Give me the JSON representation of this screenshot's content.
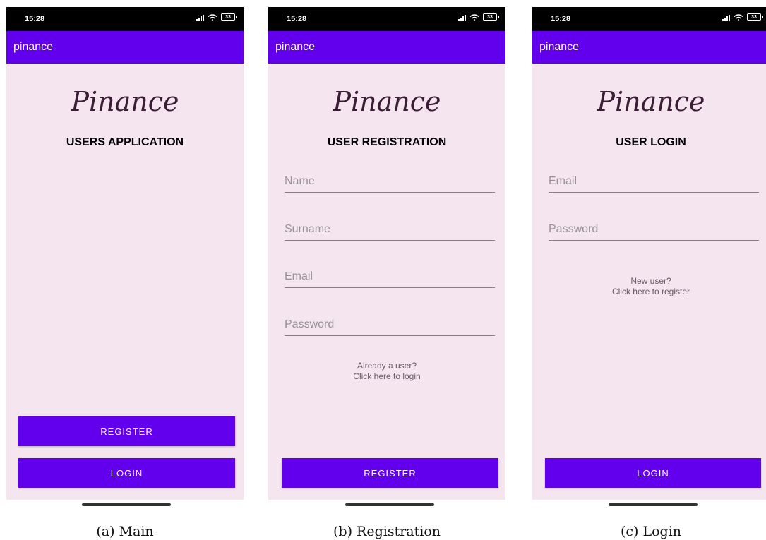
{
  "status": {
    "time": "15:28",
    "battery": "33"
  },
  "app_title": "pinance",
  "logo_text": "Pinance",
  "main": {
    "subtitle": "USERS APPLICATION",
    "register_label": "REGISTER",
    "login_label": "LOGIN",
    "caption": "(a) Main"
  },
  "registration": {
    "subtitle": "USER REGISTRATION",
    "name_placeholder": "Name",
    "surname_placeholder": "Surname",
    "email_placeholder": "Email",
    "password_placeholder": "Password",
    "link_line1": "Already a user?",
    "link_line2": "Click here to login",
    "register_label": "REGISTER",
    "caption": "(b) Registration"
  },
  "login": {
    "subtitle": "USER LOGIN",
    "email_placeholder": "Email",
    "password_placeholder": "Password",
    "link_line1": "New user?",
    "link_line2": "Click here to register",
    "login_label": "LOGIN",
    "caption": "(c) Login"
  },
  "colors": {
    "accent": "#6200ee",
    "screen_bg": "#f4e5ef",
    "logo": "#3b1d36"
  },
  "icons": [
    "signal-icon",
    "wifi-icon",
    "battery-icon"
  ]
}
